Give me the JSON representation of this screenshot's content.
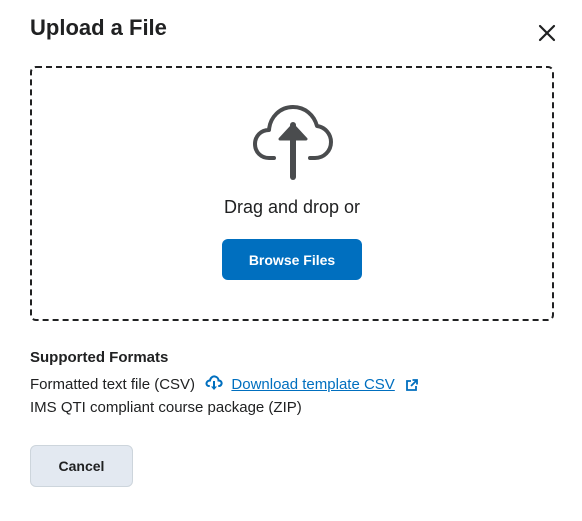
{
  "dialog": {
    "title": "Upload a File",
    "close_icon": "close-icon"
  },
  "dropzone": {
    "icon": "cloud-upload-icon",
    "text": "Drag and drop or",
    "browse_label": "Browse Files"
  },
  "formats": {
    "heading": "Supported Formats",
    "csv_label": "Formatted text file (CSV)",
    "download_icon": "download-cloud-icon",
    "download_link": "Download template CSV",
    "external_icon": "external-link-icon",
    "zip_label": "IMS QTI compliant course package (ZIP)"
  },
  "footer": {
    "cancel_label": "Cancel"
  },
  "colors": {
    "primary": "#006fbf",
    "text": "#202122",
    "secondary_button": "#e3e9f1"
  }
}
